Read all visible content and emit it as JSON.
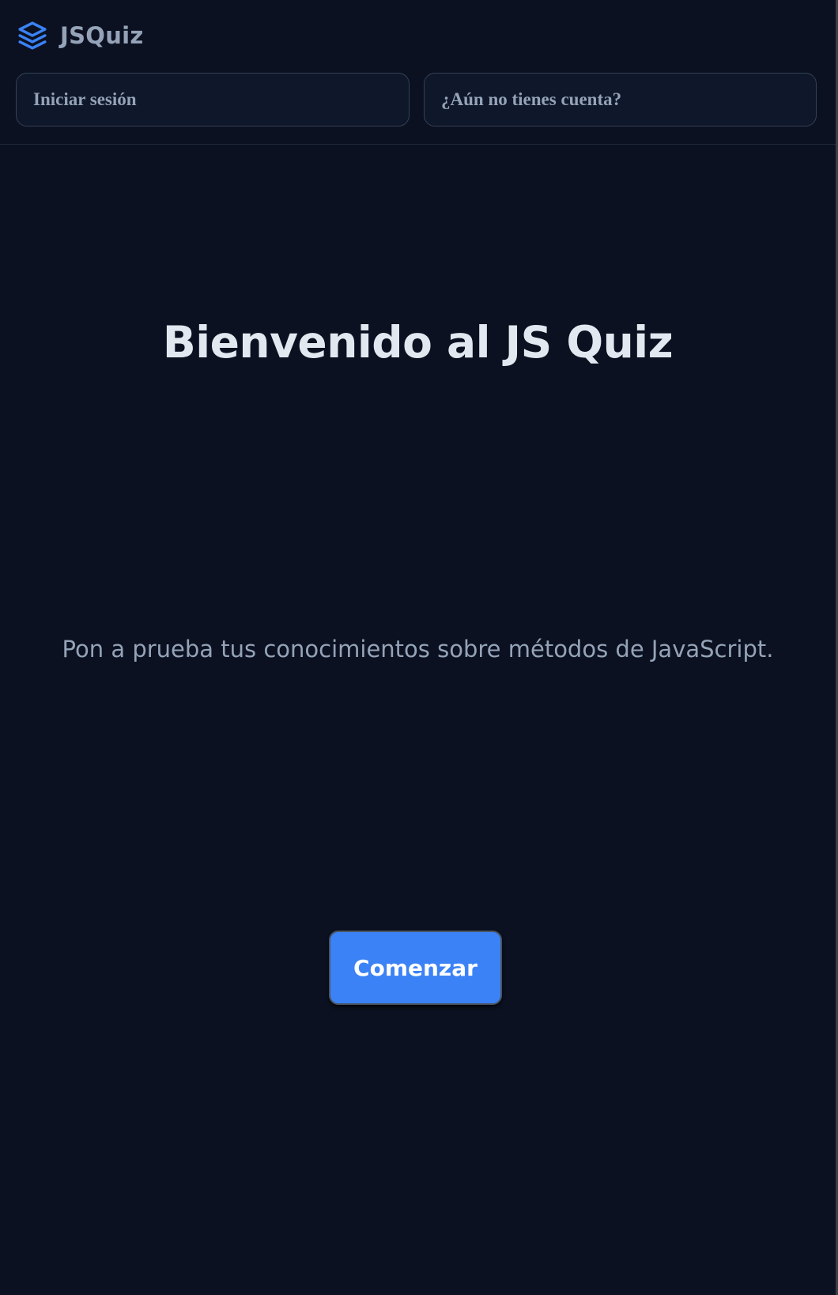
{
  "brand": {
    "name": "JSQuiz",
    "icon": "layers-icon",
    "icon_color": "#3b82f6"
  },
  "header": {
    "login_label": "Iniciar sesión",
    "signup_label": "¿Aún no tienes cuenta?"
  },
  "hero": {
    "title": "Bienvenido al JS Quiz",
    "subtitle": "Pon a prueba tus conocimientos sobre métodos de JavaScript.",
    "start_label": "Comenzar"
  },
  "colors": {
    "background": "#0b1120",
    "accent": "#3b82f6",
    "title_text": "#e2e8f0",
    "muted_text": "#94a3b8"
  }
}
